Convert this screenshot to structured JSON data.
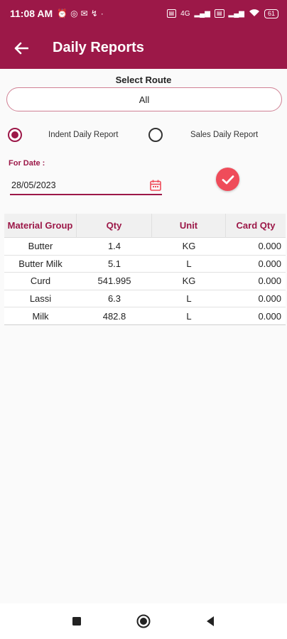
{
  "status_bar": {
    "time": "11:08 AM",
    "network": "4G",
    "battery": "61"
  },
  "app_bar": {
    "title": "Daily Reports"
  },
  "route": {
    "label": "Select Route",
    "selected": "All"
  },
  "report_types": [
    {
      "label": "Indent Daily Report",
      "checked": true
    },
    {
      "label": "Sales Daily Report",
      "checked": false
    }
  ],
  "date": {
    "label": "For Date :",
    "value": "28/05/2023"
  },
  "table": {
    "headers": [
      "Material Group",
      "Qty",
      "Unit",
      "Card Qty"
    ],
    "rows": [
      [
        "Butter",
        "1.4",
        "KG",
        "0.000"
      ],
      [
        "Butter Milk",
        "5.1",
        "L",
        "0.000"
      ],
      [
        "Curd",
        "541.995",
        "KG",
        "0.000"
      ],
      [
        "Lassi",
        "6.3",
        "L",
        "0.000"
      ],
      [
        "Milk",
        "482.8",
        "L",
        "0.000"
      ]
    ]
  },
  "colors": {
    "primary": "#9c1848",
    "accent": "#ef4c5a"
  },
  "icons": {
    "back": "arrow-left-icon",
    "calendar": "calendar-icon",
    "submit": "check-icon",
    "nav_recents": "square-icon",
    "nav_home": "circle-icon",
    "nav_back": "triangle-icon"
  }
}
